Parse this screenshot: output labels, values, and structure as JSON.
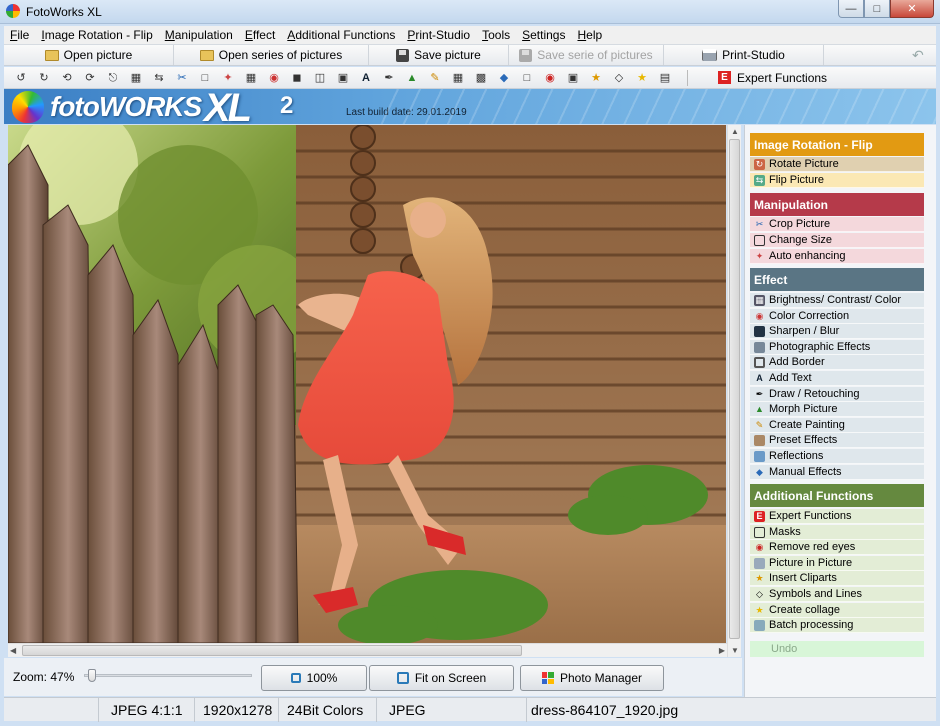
{
  "window": {
    "title": "FotoWorks XL"
  },
  "menu": [
    "File",
    "Image Rotation - Flip",
    "Manipulation",
    "Effect",
    "Additional Functions",
    "Print-Studio",
    "Tools",
    "Settings",
    "Help"
  ],
  "toolbar": {
    "open_picture": "Open picture",
    "open_series": "Open series of pictures",
    "save_picture": "Save picture",
    "save_series": "Save serie of pictures",
    "print_studio": "Print-Studio",
    "expert_functions": "Expert Functions"
  },
  "banner": {
    "brand": "fotoWORKS",
    "brand_xl": "XL",
    "version": "2",
    "build_date": "Last build date: 29.01.2019"
  },
  "zoom": {
    "label": "Zoom: 47%",
    "level_percent": 47
  },
  "buttons": {
    "hundred": "100%",
    "fit": "Fit on Screen",
    "photo_manager": "Photo Manager"
  },
  "panel": {
    "sections": [
      {
        "title": "Image Rotation - Flip",
        "color": "#e29a12",
        "item_bg": "#fbe8b4",
        "items": [
          "Rotate Picture",
          "Flip Picture"
        ]
      },
      {
        "title": "Manipulation",
        "color": "#b53a4a",
        "item_bg": "#f4d8dc",
        "items": [
          "Crop Picture",
          "Change Size",
          "Auto enhancing"
        ]
      },
      {
        "title": "Effect",
        "color": "#5a7584",
        "item_bg": "#dfe7ec",
        "items": [
          "Brightness/ Contrast/ Color",
          "Color Correction",
          "Sharpen / Blur",
          "Photographic Effects",
          "Add Border",
          "Add Text",
          "Draw / Retouching",
          "Morph Picture",
          "Create Painting",
          "Preset Effects",
          "Reflections",
          "Manual Effects"
        ]
      },
      {
        "title": "Additional Functions",
        "color": "#65893f",
        "item_bg": "#e3edd6",
        "items": [
          "Expert Functions",
          "Masks",
          "Remove red eyes",
          "Picture in Picture",
          "Insert Cliparts",
          "Symbols and Lines",
          "Create collage",
          "Batch processing"
        ]
      }
    ],
    "undo": "Undo"
  },
  "status": {
    "format": "JPEG  4:1:1",
    "size": "1920x1278",
    "colors": "24Bit Colors",
    "type": "JPEG",
    "file": "dress-864107_1920.jpg"
  }
}
